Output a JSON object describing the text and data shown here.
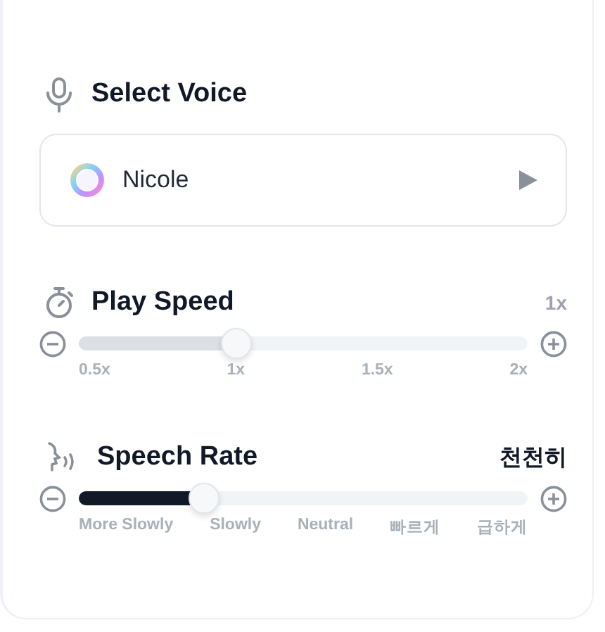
{
  "voice_section": {
    "title": "Select Voice",
    "voice": "Nicole"
  },
  "sliders": [
    {
      "kind": "speed",
      "title": "Play Speed",
      "value": "1x",
      "level": 0.35,
      "color": "#dcdfe4",
      "ticks": [
        "0.5x",
        "1x",
        "1.5x",
        "2x"
      ]
    },
    {
      "kind": "rate",
      "title": "Speech Rate",
      "value": "천천히",
      "level": 0.28,
      "color": "#111827",
      "ticks": [
        "More Slowly",
        "Slowly",
        "Neutral",
        "빠르게",
        "급하게"
      ]
    }
  ]
}
